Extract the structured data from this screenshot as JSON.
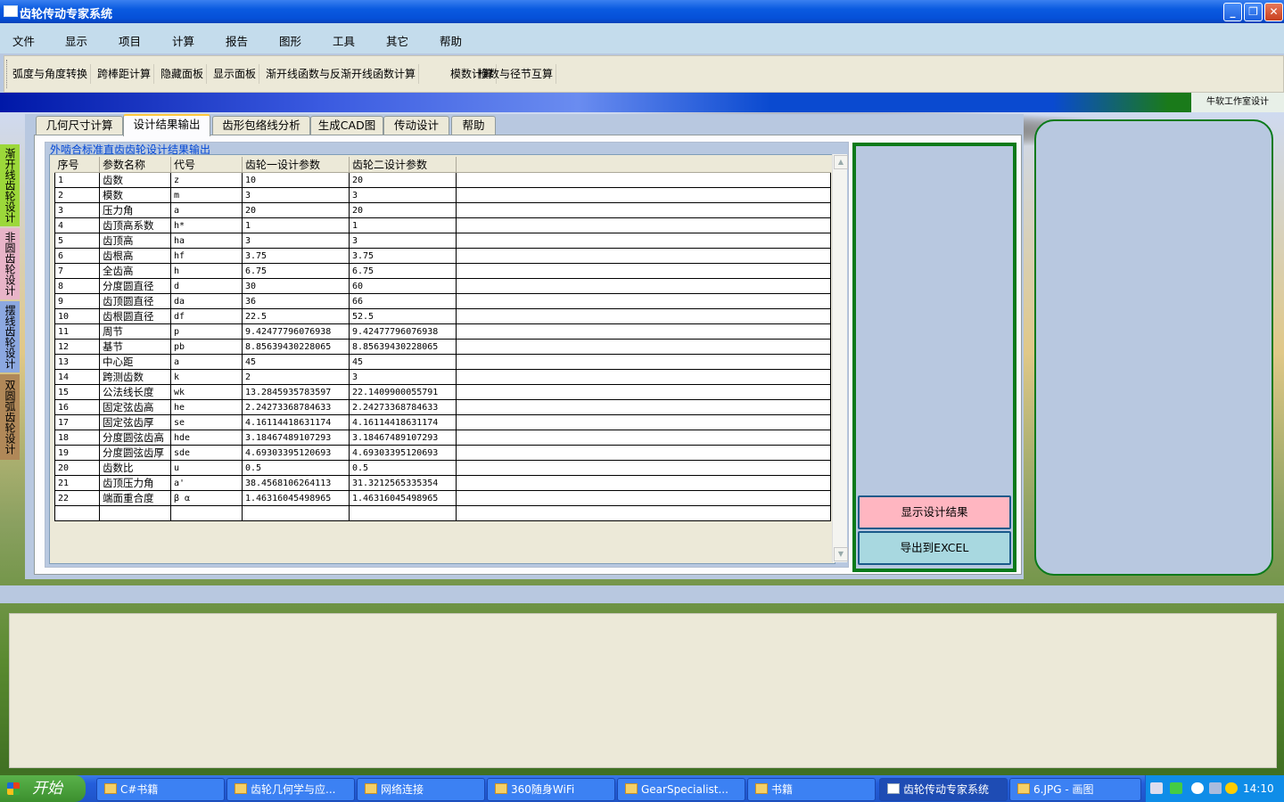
{
  "window": {
    "title": "齿轮传动专家系统"
  },
  "menu": [
    "文件",
    "显示",
    "项目",
    "计算",
    "报告",
    "图形",
    "工具",
    "其它",
    "帮助"
  ],
  "toolbar": [
    "弧度与角度转换",
    "跨棒距计算",
    "隐藏面板",
    "显示面板",
    "渐开线函数与反渐开线函数计算",
    "模数计算",
    "模数与径节互算"
  ],
  "studio_label": "牛软工作室设计",
  "side_tabs": [
    "渐开线齿轮设计",
    "非圆齿轮设计",
    "摆线齿轮设计",
    "双圆弧齿轮设计"
  ],
  "tabs": [
    "几何尺寸计算",
    "设计结果输出",
    "齿形包络线分析",
    "生成CAD图",
    "传动设计",
    "帮助"
  ],
  "active_tab": "设计结果输出",
  "group_title": "外啮合标准直齿齿轮设计结果输出",
  "table": {
    "headers": [
      "序号",
      "参数名称",
      "代号",
      "齿轮一设计参数",
      "齿轮二设计参数"
    ],
    "rows": [
      [
        "1",
        "齿数",
        "z",
        "10",
        "20"
      ],
      [
        "2",
        "模数",
        "m",
        "3",
        "3"
      ],
      [
        "3",
        "压力角",
        "a",
        "20",
        "20"
      ],
      [
        "4",
        "齿顶高系数",
        "h*",
        "1",
        "1"
      ],
      [
        "5",
        "齿顶高",
        "ha",
        "3",
        "3"
      ],
      [
        "6",
        "齿根高",
        "hf",
        "3.75",
        "3.75"
      ],
      [
        "7",
        "全齿高",
        "h",
        "6.75",
        "6.75"
      ],
      [
        "8",
        "分度圆直径",
        "d",
        "30",
        "60"
      ],
      [
        "9",
        "齿顶圆直径",
        "da",
        "36",
        "66"
      ],
      [
        "10",
        "齿根圆直径",
        "df",
        "22.5",
        "52.5"
      ],
      [
        "11",
        "周节",
        "p",
        "9.42477796076938",
        "9.42477796076938"
      ],
      [
        "12",
        "基节",
        "pb",
        "8.85639430228065",
        "8.85639430228065"
      ],
      [
        "13",
        "中心距",
        "a",
        "45",
        "45"
      ],
      [
        "14",
        "跨测齿数",
        "k",
        "2",
        "3"
      ],
      [
        "15",
        "公法线长度",
        "wk",
        "13.2845935783597",
        "22.1409900055791"
      ],
      [
        "16",
        "固定弦齿高",
        "he",
        "2.24273368784633",
        "2.24273368784633"
      ],
      [
        "17",
        "固定弦齿厚",
        "se",
        "4.16114418631174",
        "4.16114418631174"
      ],
      [
        "18",
        "分度圆弦齿高",
        "hde",
        "3.18467489107293",
        "3.18467489107293"
      ],
      [
        "19",
        "分度圆弦齿厚",
        "sde",
        "4.69303395120693",
        "4.69303395120693"
      ],
      [
        "20",
        "齿数比",
        "u",
        "0.5",
        "0.5"
      ],
      [
        "21",
        "齿顶压力角",
        "a'",
        "38.4568106264113",
        "31.3212565335354"
      ],
      [
        "22",
        "端面重合度",
        "β α",
        "1.46316045498965",
        "1.46316045498965"
      ]
    ]
  },
  "buttons": {
    "show_results": "显示设计结果",
    "export_excel": "导出到EXCEL"
  },
  "taskbar": {
    "start": "开始",
    "tasks": [
      "C#书籍",
      "齿轮几何学与应...",
      "网络连接",
      "360随身WiFi",
      "GearSpecialist...",
      "书籍",
      "齿轮传动专家系统",
      "6.JPG - 画图"
    ],
    "active_task": "齿轮传动专家系统",
    "clock": "14:10"
  },
  "colors": {
    "title_blue": "#0a5ae0",
    "panel_bg": "#b8c8e0",
    "green_border": "#0a7a1a",
    "show_btn": "#ffb6c1",
    "excel_btn": "#a8d8e0"
  }
}
